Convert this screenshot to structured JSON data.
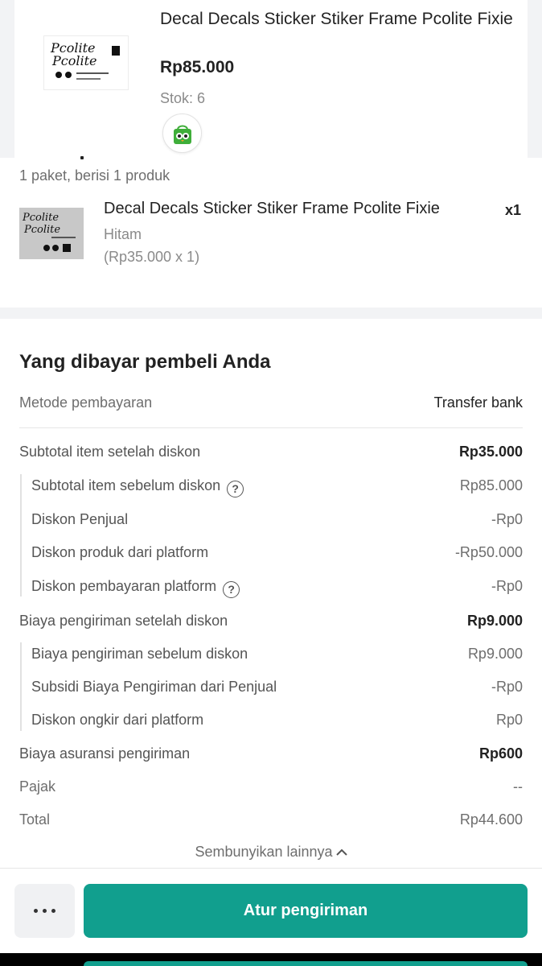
{
  "top_product": {
    "title": "Decal Decals Sticker Stiker Frame Pcolite Fixie",
    "price": "Rp85.000",
    "stock": "Stok: 6",
    "thumb_text_1": "Pcolite",
    "thumb_text_2": "Pcolite"
  },
  "package": {
    "summary": "1 paket, berisi 1 produk",
    "item": {
      "name": "Decal Decals Sticker Stiker Frame Pcolite Fixie",
      "qty": "x1",
      "variant": "Hitam",
      "unit_price": "(Rp35.000 x 1)",
      "thumb_text_1": "Pcolite",
      "thumb_text_2": "Pcolite"
    }
  },
  "payment": {
    "title": "Yang dibayar pembeli Anda",
    "method_label": "Metode pembayaran",
    "method_value": "Transfer bank",
    "rows": [
      {
        "label": "Subtotal item setelah diskon",
        "value": "Rp35.000"
      },
      {
        "label": "Subtotal item sebelum diskon",
        "value": "Rp85.000"
      },
      {
        "label": "Diskon Penjual",
        "value": "-Rp0"
      },
      {
        "label": "Diskon produk dari platform",
        "value": "-Rp50.000"
      },
      {
        "label": "Diskon pembayaran platform",
        "value": "-Rp0"
      },
      {
        "label": "Biaya pengiriman setelah diskon",
        "value": "Rp9.000"
      },
      {
        "label": "Biaya pengiriman sebelum diskon",
        "value": "Rp9.000"
      },
      {
        "label": "Subsidi Biaya Pengiriman dari Penjual",
        "value": "-Rp0"
      },
      {
        "label": "Diskon ongkir dari platform",
        "value": "Rp0"
      },
      {
        "label": "Biaya asuransi pengiriman",
        "value": "Rp600"
      },
      {
        "label": "Pajak",
        "value": "--"
      },
      {
        "label": "Total",
        "value": "Rp44.600"
      }
    ],
    "help_glyph": "?",
    "collapse_label": "Sembunyikan lainnya"
  },
  "bottom_bar": {
    "primary_label": "Atur pengiriman"
  },
  "colors": {
    "accent": "#119f8e",
    "background": "#f2f3f5"
  }
}
